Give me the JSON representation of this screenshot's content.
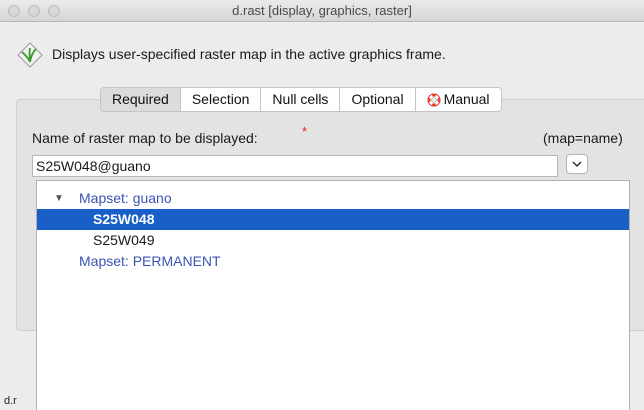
{
  "window": {
    "title": "d.rast [display, graphics, raster]"
  },
  "description": {
    "icon": "grass-module-icon",
    "text": "Displays user-specified raster map in the active graphics frame."
  },
  "tabs": [
    {
      "label": "Required",
      "active": true
    },
    {
      "label": "Selection",
      "active": false
    },
    {
      "label": "Null cells",
      "active": false
    },
    {
      "label": "Optional",
      "active": false
    },
    {
      "label": "Manual",
      "active": false,
      "icon": "lifebuoy-icon"
    }
  ],
  "map_field": {
    "label": "Name of raster map to be displayed:",
    "required_marker": "*",
    "param": "(map=name)",
    "value": "S25W048@guano"
  },
  "dropdown": {
    "items": [
      {
        "label": "Mapset: guano",
        "kind": "group",
        "expanded": true
      },
      {
        "label": "S25W048",
        "kind": "item",
        "selected": true
      },
      {
        "label": "S25W049",
        "kind": "item",
        "selected": false
      },
      {
        "label": "Mapset: PERMANENT",
        "kind": "group",
        "expanded": false
      }
    ]
  },
  "statusbar": {
    "text": "d.r"
  },
  "colors": {
    "selection": "#1a5fc8",
    "group_text": "#3b54b5",
    "required_marker": "#e02020"
  }
}
